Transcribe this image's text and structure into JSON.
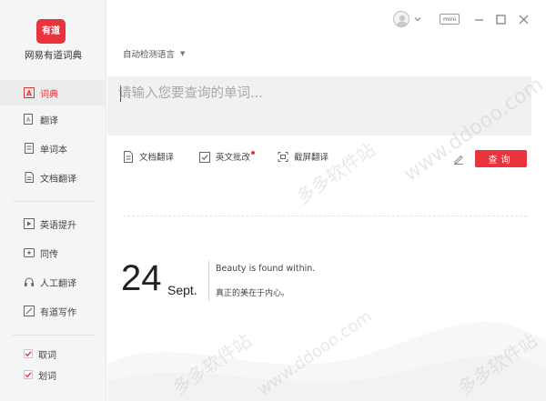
{
  "app": {
    "logo_text": "有道",
    "name": "网易有道词典"
  },
  "sidebar": {
    "items": [
      {
        "label": "词典",
        "icon": "dict-icon",
        "active": true
      },
      {
        "label": "翻译",
        "icon": "translate-icon",
        "active": false
      },
      {
        "label": "单词本",
        "icon": "wordbook-icon",
        "active": false
      },
      {
        "label": "文档翻译",
        "icon": "doc-translate-icon",
        "active": false
      },
      {
        "label": "英语提升",
        "icon": "english-improve-icon",
        "active": false
      },
      {
        "label": "同传",
        "icon": "interpretation-icon",
        "active": false
      },
      {
        "label": "人工翻译",
        "icon": "human-translate-icon",
        "active": false
      },
      {
        "label": "有道写作",
        "icon": "writing-icon",
        "active": false
      }
    ],
    "checks": [
      {
        "label": "取词",
        "checked": true
      },
      {
        "label": "划词",
        "checked": true
      }
    ]
  },
  "titlebar": {
    "mini_label": "mini",
    "controls": [
      "minimize-icon",
      "maximize-icon",
      "close-icon"
    ]
  },
  "search": {
    "language_select": "自动检测语言",
    "placeholder": "请输入您要查询的单词..."
  },
  "tools": [
    {
      "label": "文档翻译",
      "icon": "doc-icon"
    },
    {
      "label": "英文批改",
      "icon": "correct-icon",
      "badge": true
    },
    {
      "label": "截屏翻译",
      "icon": "screenshot-icon"
    }
  ],
  "query_button": "查询",
  "daily": {
    "day": "24",
    "month": "Sept.",
    "quote_en": "Beauty is found within.",
    "quote_cn": "真正的美在于内心。"
  },
  "watermark": {
    "cn": "多多软件站",
    "url": "www.ddooo.com"
  },
  "colors": {
    "accent": "#e8343d",
    "sidebar_bg": "#f5f5f5",
    "search_bg": "#f1f1f1"
  }
}
